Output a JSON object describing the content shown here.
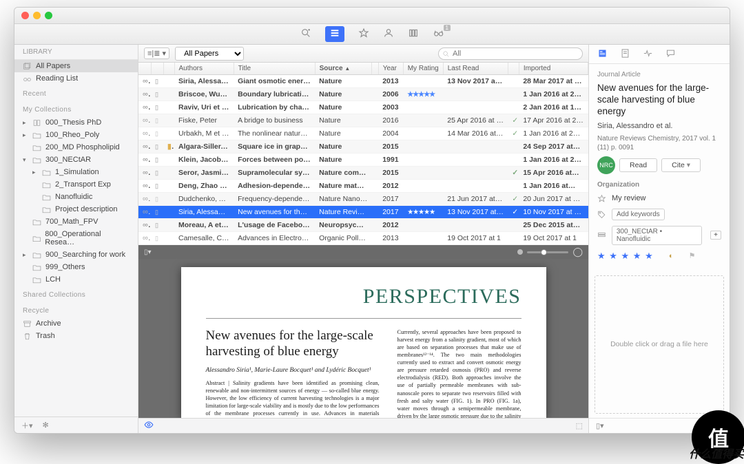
{
  "sidebar": {
    "header": "LIBRARY",
    "toplevel": [
      {
        "label": "All Papers",
        "sel": true
      },
      {
        "label": "Reading List"
      }
    ],
    "sections": [
      {
        "title": "Recent",
        "items": []
      },
      {
        "title": "My Collections",
        "items": [
          {
            "d": "▸",
            "label": "000_Thesis PhD",
            "icon": "book"
          },
          {
            "d": "▸",
            "label": "100_Rheo_Poly"
          },
          {
            "d": "",
            "label": "200_MD Phospholipid"
          },
          {
            "d": "▾",
            "label": "300_NECtAR",
            "children": [
              {
                "d": "▸",
                "label": "1_Simulation"
              },
              {
                "d": "",
                "label": "2_Transport Exp"
              },
              {
                "d": "",
                "label": "Nanofluidic"
              },
              {
                "d": "",
                "label": "Project description"
              }
            ]
          },
          {
            "d": "",
            "label": "700_Math_FPV"
          },
          {
            "d": "",
            "label": "800_Operational Resea…"
          },
          {
            "d": "▸",
            "label": "900_Searching for work"
          },
          {
            "d": "",
            "label": "999_Others"
          },
          {
            "d": "",
            "label": "LCH"
          }
        ]
      },
      {
        "title": "Shared Collections",
        "items": []
      },
      {
        "title": "Recycle",
        "items": [
          {
            "label": "Archive",
            "icon": "archive"
          },
          {
            "label": "Trash",
            "icon": "trash"
          }
        ]
      }
    ]
  },
  "filter": {
    "dropdown": "All Papers",
    "search_placeholder": "All"
  },
  "columns": [
    "",
    "",
    "",
    "Authors",
    "Title",
    "Source",
    "",
    "Year",
    "My Rating",
    "Last Read",
    "",
    "Imported"
  ],
  "rows": [
    {
      "a": "Siria, Alessandro…",
      "t": "Giant osmotic energy co…",
      "s": "Nature",
      "y": "2013",
      "r": "",
      "lr": "13 Nov 2017 at 1…",
      "chk": "",
      "im": "28 Mar 2017 at 1…",
      "bold": true
    },
    {
      "a": "Briscoe, Wuge…",
      "t": "Boundary lubrication u…",
      "s": "Nature",
      "y": "2006",
      "r": "★★★★★",
      "lr": "",
      "chk": "",
      "im": "1 Jan 2016 at 2…",
      "bold": true,
      "alt": true
    },
    {
      "a": "Raviv, Uri et al.",
      "t": "Lubrication by charge…",
      "s": "Nature",
      "y": "2003",
      "r": "",
      "lr": "",
      "chk": "",
      "im": "2 Jan 2016 at 1…",
      "bold": true
    },
    {
      "a": "Fiske, Peter",
      "t": "A bridge to business",
      "s": "Nature",
      "y": "2016",
      "r": "",
      "lr": "25 Apr 2016 at 1…",
      "chk": "✓",
      "im": "17 Apr 2016 at 2…",
      "alt": true
    },
    {
      "a": "Urbakh, M et al.",
      "t": "The nonlinear nature of…",
      "s": "Nature",
      "y": "2004",
      "r": "",
      "lr": "14 Mar 2016 at 21:…",
      "chk": "✓",
      "im": "1 Jan 2016 at 21:…"
    },
    {
      "a": "Algara-Siller, G…",
      "t": "Square ice in graphene…",
      "s": "Nature",
      "y": "2015",
      "r": "",
      "lr": "",
      "chk": "",
      "im": "24 Sep 2017 at…",
      "bold": true,
      "note": true,
      "alt": true
    },
    {
      "a": "Klein, Jacob et…",
      "t": "Forces between polym…",
      "s": "Nature",
      "y": "1991",
      "r": "",
      "lr": "",
      "chk": "",
      "im": "1 Jan 2016 at 2…",
      "bold": true
    },
    {
      "a": "Seror, Jasmine…",
      "t": "Supramolecular syner…",
      "s": "Nature commu…",
      "y": "2015",
      "r": "",
      "lr": "",
      "chk": "✓",
      "im": "15 Apr 2016 at…",
      "bold": true,
      "alt": true
    },
    {
      "a": "Deng, Zhao et al.",
      "t": "Adhesion-dependent n…",
      "s": "Nature materials",
      "y": "2012",
      "r": "",
      "lr": "",
      "chk": "",
      "im": "1 Jan 2016 at…",
      "bold": true
    },
    {
      "a": "Dudchenko, Alex…",
      "t": "Frequency-dependent s…",
      "s": "Nature Nanotech…",
      "y": "2017",
      "r": "",
      "lr": "21 Jun 2017 at 1…",
      "chk": "✓",
      "im": "20 Jun 2017 at 1…",
      "alt": true
    },
    {
      "a": "Siria, Alessandro…",
      "t": "New avenues for the lar…",
      "s": "Nature Reviews…",
      "y": "2017",
      "r": "★★★★★",
      "lr": "13 Nov 2017 at 1…",
      "chk": "✓",
      "im": "10 Nov 2017 at 1…",
      "sel": true
    },
    {
      "a": "Moreau, A et al.",
      "t": "L'usage de Facebook e…",
      "s": "Neuropsychiatr…",
      "y": "2012",
      "r": "",
      "lr": "",
      "chk": "",
      "im": "25 Dec 2015 at…",
      "bold": true,
      "alt": true
    },
    {
      "a": "Camesalle, Clau",
      "t": "Advances in Electrokinet",
      "s": "Organic Pollutan",
      "y": "2013",
      "r": "",
      "lr": "19 Oct 2017 at 1",
      "chk": "",
      "im": "19 Oct 2017 at 1"
    }
  ],
  "pdf": {
    "hero": "PERSPECTIVES",
    "title": "New avenues for the large-scale harvesting of blue energy",
    "authors": "Alessandro Siria¹, Marie-Laure Bocquet¹ and Lydéric Bocquet¹",
    "abstract": "Abstract | Salinity gradients have been identified as promising clean, renewable and non-intermittent sources of energy — so-called blue energy. However, the low efficiency of current harvesting technologies is a major limitation for large-scale viability and is mostly due to the low performances of the membrane processes currently in use. Advances in materials fabrication with dedicated chemical properties can resolve this bottleneck and lead to a new class of membranes for blue-energy conversion. In this Perspective, we briefly present current technologies for the conversion of blue energy, describe their performances and note their limitations. We then discuss new avenues for the development of a new class of membranes, combining considerations in nanoscale fluid dynamics and surface",
    "column2": "Currently, several approaches have been proposed to harvest energy from a salinity gradient, most of which are based on separation processes that make use of membranes¹²⁻¹⁴. The two main methodologies currently used to extract and convert osmotic energy are pressure retarded osmosis (PRO) and reverse electrodialysis (RED). Both approaches involve the use of partially permeable membranes with sub-nanoscale pores to separate two reservoirs filled with fresh and salty water (FIG. 1). In PRO (FIG. 1a), water moves through a semipermeable membrane, driven by the large osmotic pressure due to the salinity difference between the two sides of the membrane. At the sea–river interface, the osmotic pressure drop can be as large as 30 bars and is even larger in the presence of brines or wastewaters. Water flows from the"
  },
  "inspector": {
    "kind": "Journal Article",
    "title": "New avenues for the large-scale harvesting of blue energy",
    "authors": "Siria, Alessandro et al.",
    "meta": "Nature Reviews Chemistry, 2017 vol. 1 (11) p. 0091",
    "avatar": "NRC",
    "read": "Read",
    "cite": "Cite",
    "org": "Organization",
    "review": "My review",
    "kw": "Add keywords",
    "coll": "300_NECtAR • Nanofluidic",
    "stars": "★ ★ ★ ★ ★",
    "drop": "Double click or drag a file here"
  },
  "toolbar_badge": "1",
  "watermark": "值",
  "watermark_text": "什么值得买"
}
